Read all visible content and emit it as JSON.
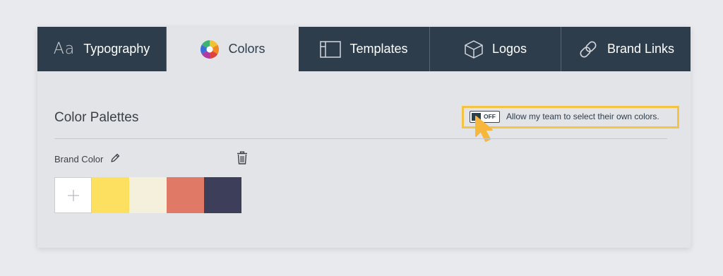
{
  "tabs": [
    {
      "label": "Typography",
      "icon": "typography-icon",
      "glyph": "Aa",
      "active": false
    },
    {
      "label": "Colors",
      "icon": "color-wheel-icon",
      "active": true
    },
    {
      "label": "Templates",
      "icon": "template-icon",
      "active": false
    },
    {
      "label": "Logos",
      "icon": "cube-icon",
      "active": false
    },
    {
      "label": "Brand Links",
      "icon": "link-icon",
      "active": false
    }
  ],
  "section": {
    "title": "Color Palettes"
  },
  "team_toggle": {
    "state": "OFF",
    "label": "Allow my team to select their own colors."
  },
  "palette": {
    "name": "Brand Color",
    "swatches": [
      "#fde05f",
      "#f4f0dc",
      "#e07a66",
      "#3d3f5a"
    ]
  },
  "colors": {
    "tab_bg": "#2e3d4c",
    "highlight": "#f6c444",
    "cursor": "#f6b73c"
  }
}
